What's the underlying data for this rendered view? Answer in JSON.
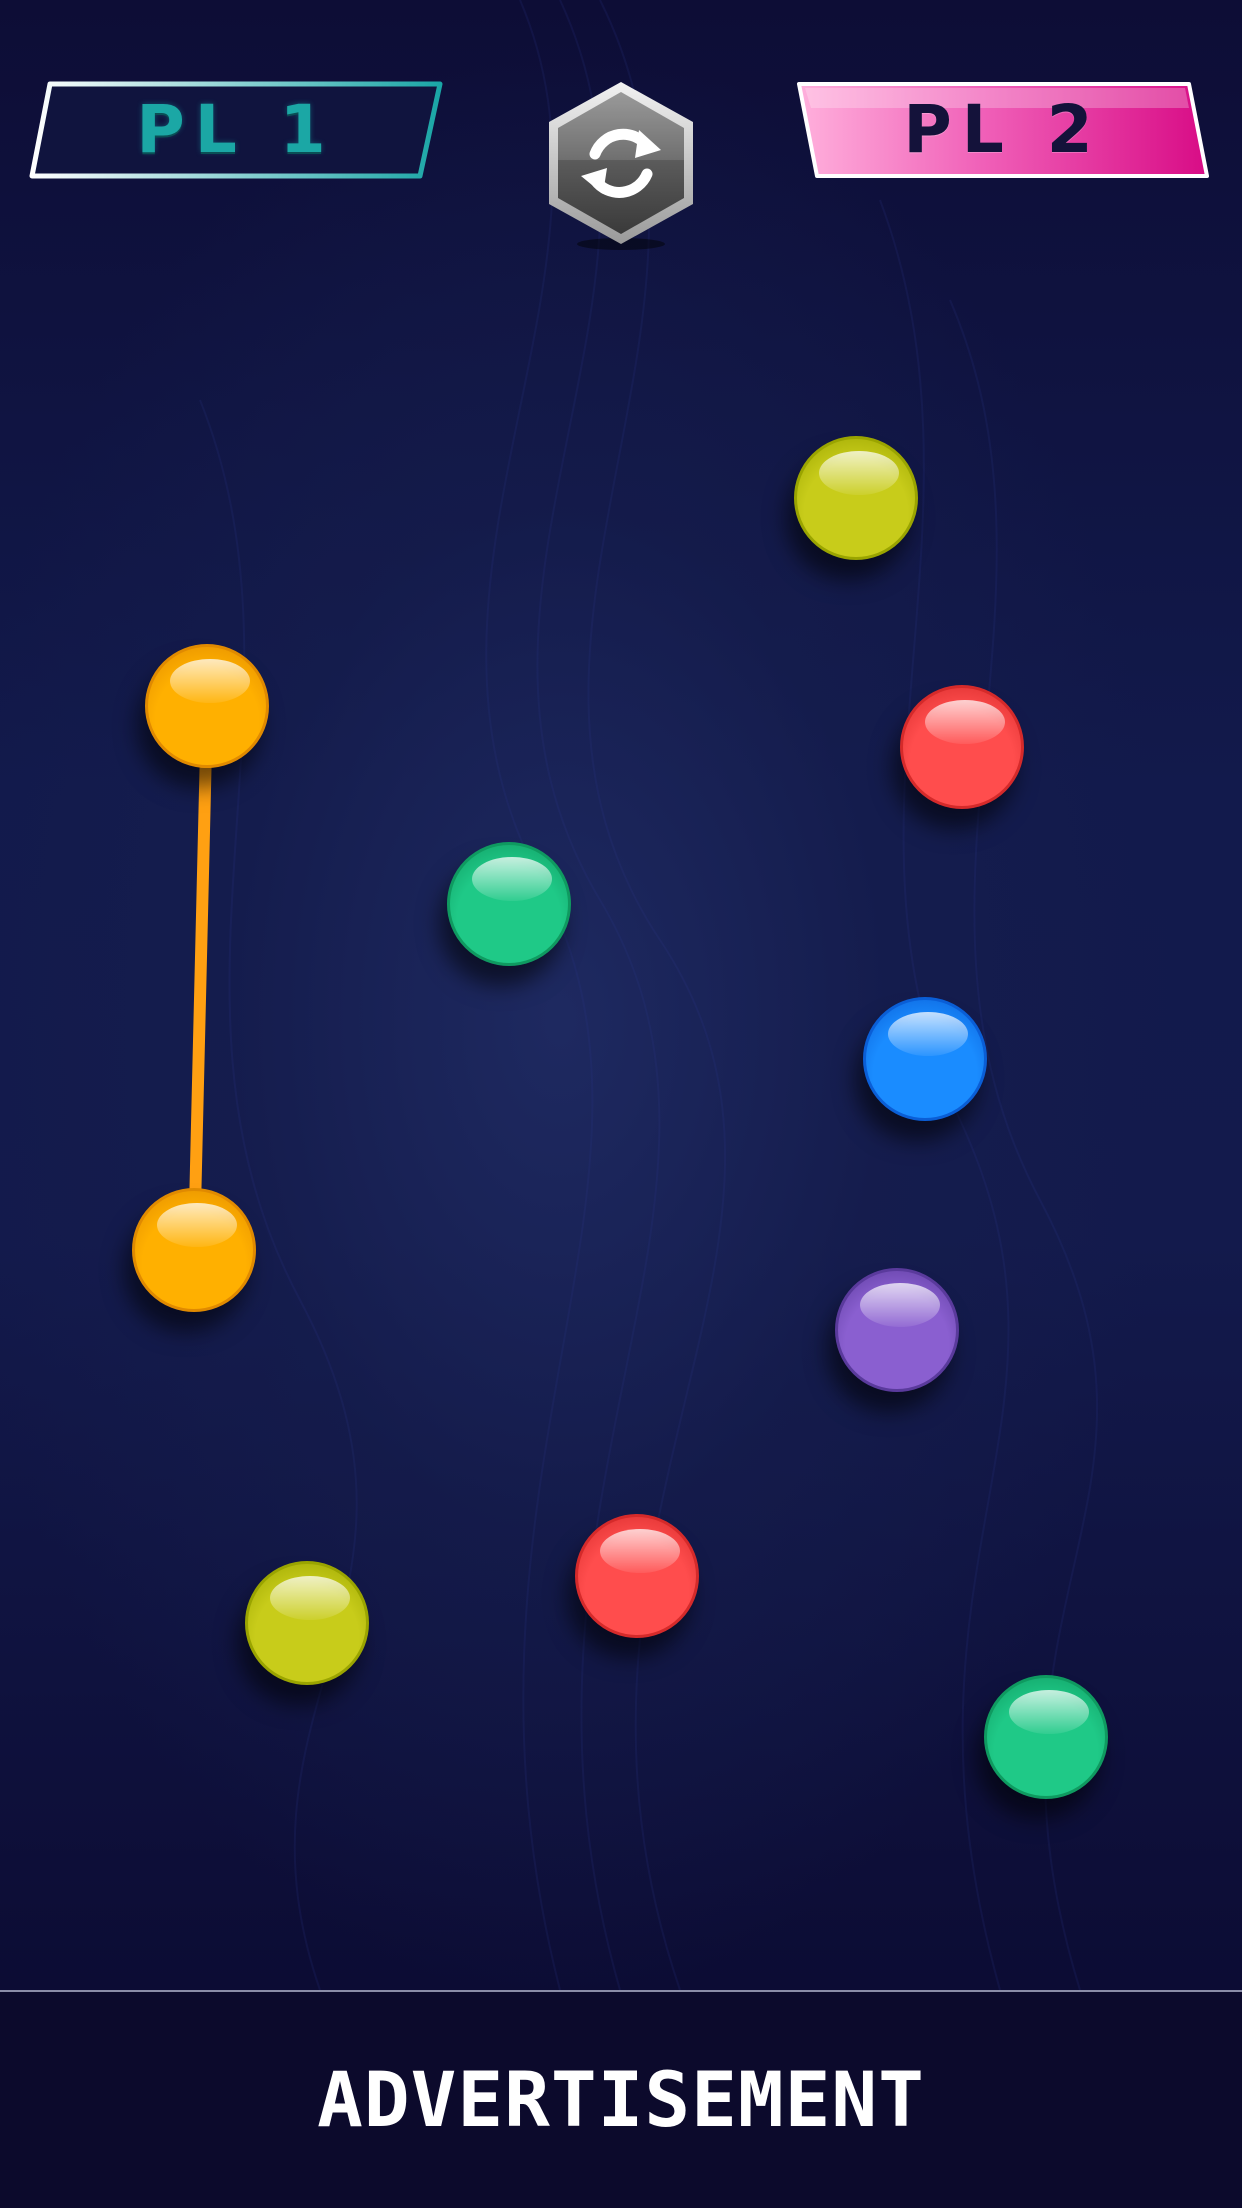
{
  "players": {
    "player1": {
      "label": "PL 1"
    },
    "player2": {
      "label": "PL 2"
    }
  },
  "restart": {
    "icon": "restart-icon"
  },
  "balls": [
    {
      "id": "yellow-green-top",
      "color": "yellow-green",
      "fill": "#c8cc1a",
      "rim": "#9aa400"
    },
    {
      "id": "orange-top",
      "color": "orange",
      "fill": "#ffb000",
      "rim": "#e08a00"
    },
    {
      "id": "red-top",
      "color": "red",
      "fill": "#ff4d4d",
      "rim": "#d52a2a"
    },
    {
      "id": "green-top",
      "color": "green",
      "fill": "#1fc987",
      "rim": "#0f9a60"
    },
    {
      "id": "blue",
      "color": "blue",
      "fill": "#1a8cff",
      "rim": "#0a5ed6"
    },
    {
      "id": "orange-bottom",
      "color": "orange",
      "fill": "#ffb000",
      "rim": "#e08a00"
    },
    {
      "id": "purple",
      "color": "purple",
      "fill": "#8a5fd0",
      "rim": "#5a3a9c"
    },
    {
      "id": "red-bottom",
      "color": "red",
      "fill": "#ff4d4d",
      "rim": "#d52a2a"
    },
    {
      "id": "yellow-green-bottom",
      "color": "yellow-green",
      "fill": "#c8cc1a",
      "rim": "#9aa400"
    },
    {
      "id": "green-bottom",
      "color": "green",
      "fill": "#1fc987",
      "rim": "#0f9a60"
    }
  ],
  "links": [
    {
      "from": "orange-top",
      "to": "orange-bottom",
      "color": "#ffa012"
    }
  ],
  "advertisement": {
    "label": "ADVERTISEMENT"
  },
  "colors": {
    "background": "#121a4c",
    "player1_accent": "#1ba7a5",
    "player2_accent": "#e0158f"
  }
}
